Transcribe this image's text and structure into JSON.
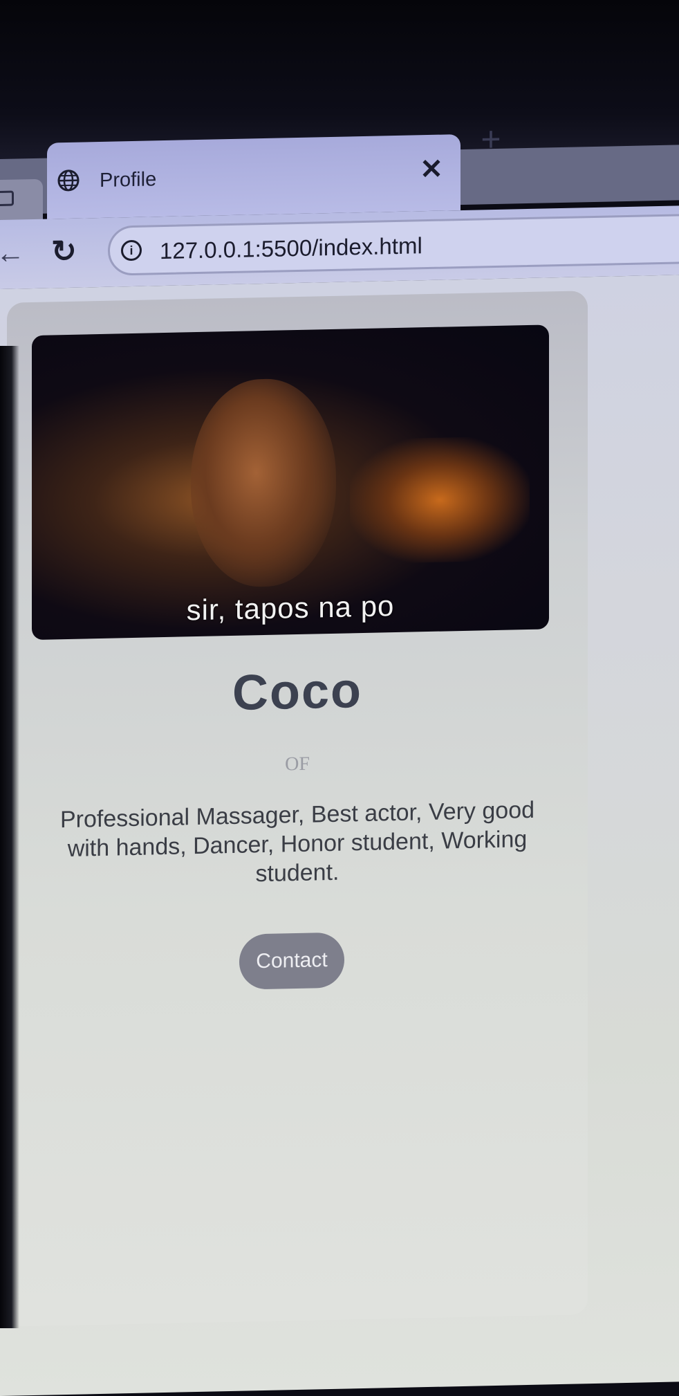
{
  "browser": {
    "tab": {
      "title": "Profile",
      "close_glyph": "✕",
      "icon": "globe-icon"
    },
    "new_tab_glyph": "+",
    "nav": {
      "back_glyph": "←",
      "reload_glyph": "↻",
      "info_glyph": "i"
    },
    "address": {
      "url": "127.0.0.1:5500/index.html"
    }
  },
  "profile": {
    "photo_caption": "sir, tapos na po",
    "name": "Coco",
    "subtitle": "OF",
    "bio": "Professional Massager, Best actor, Very good with hands, Dancer, Honor student, Working student.",
    "contact_label": "Contact"
  },
  "colors": {
    "tab_active": "#b8bbe6",
    "button_bg": "#7e7f8c",
    "name_text": "#3c4150"
  }
}
